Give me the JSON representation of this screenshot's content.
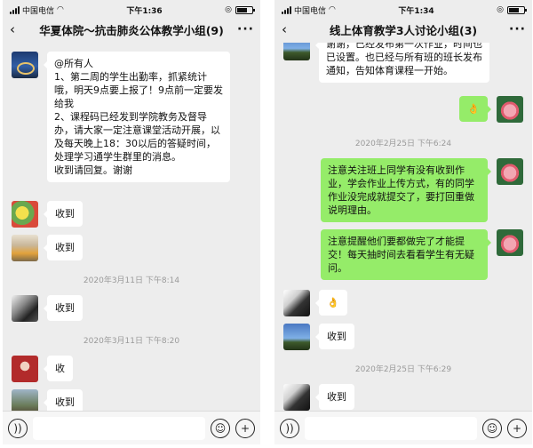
{
  "left_phone": {
    "status": {
      "carrier": "中国电信",
      "time": "下午1:36"
    },
    "title": "华夏体院～抗击肺炎公体教学小组(9)",
    "messages": [
      {
        "text": "@所有人\n1、第二周的学生出勤率，抓紧统计哦，明天9点要上报了！9点前一定要发给我\n2、课程码已经发到学院教务及督导办，请大家一定注意课堂活动开展，以及每天晚上18：30以后的答疑时间，处理学习通学生群里的消息。\n收到请回复。谢谢"
      },
      {
        "text": "收到"
      },
      {
        "text": "收到"
      },
      {
        "text": "收到"
      },
      {
        "text": "收"
      },
      {
        "text": "收到"
      }
    ],
    "timestamps": [
      "2020年3月11日 下午8:14",
      "2020年3月11日 下午8:20"
    ]
  },
  "right_phone": {
    "status": {
      "carrier": "中国电信",
      "time": "下午1:34"
    },
    "title": "线上体育教学3人讨论小组(3)",
    "messages": [
      {
        "text": "谢谢，已经发布第一次作业，时间也已设置。也已经与所有班的班长发布通知，告知体育课程一开始。"
      },
      {
        "text": "👌"
      },
      {
        "text": "注意关注班上同学有没有收到作业，学会作业上传方式，有的同学作业没完成就提交了，要打回重做说明理由。"
      },
      {
        "text": "注意提醒他们要都做完了才能提交！每天抽时间去看看学生有无疑问。"
      },
      {
        "text": "👌"
      },
      {
        "text": "收到"
      },
      {
        "text": "收到"
      }
    ],
    "timestamps": [
      "2020年2月25日 下午6:24",
      "2020年2月25日 下午6:29"
    ]
  },
  "colors": {
    "chat_background": "#ededed",
    "sent_bubble": "#95ec69",
    "received_bubble": "#ffffff",
    "timestamp_text": "#9a9a9a"
  },
  "icons": {
    "voice": "voice-icon",
    "emoji": "emoji-icon",
    "add": "plus-icon",
    "back": "chevron-left-icon",
    "more": "more-icon"
  }
}
